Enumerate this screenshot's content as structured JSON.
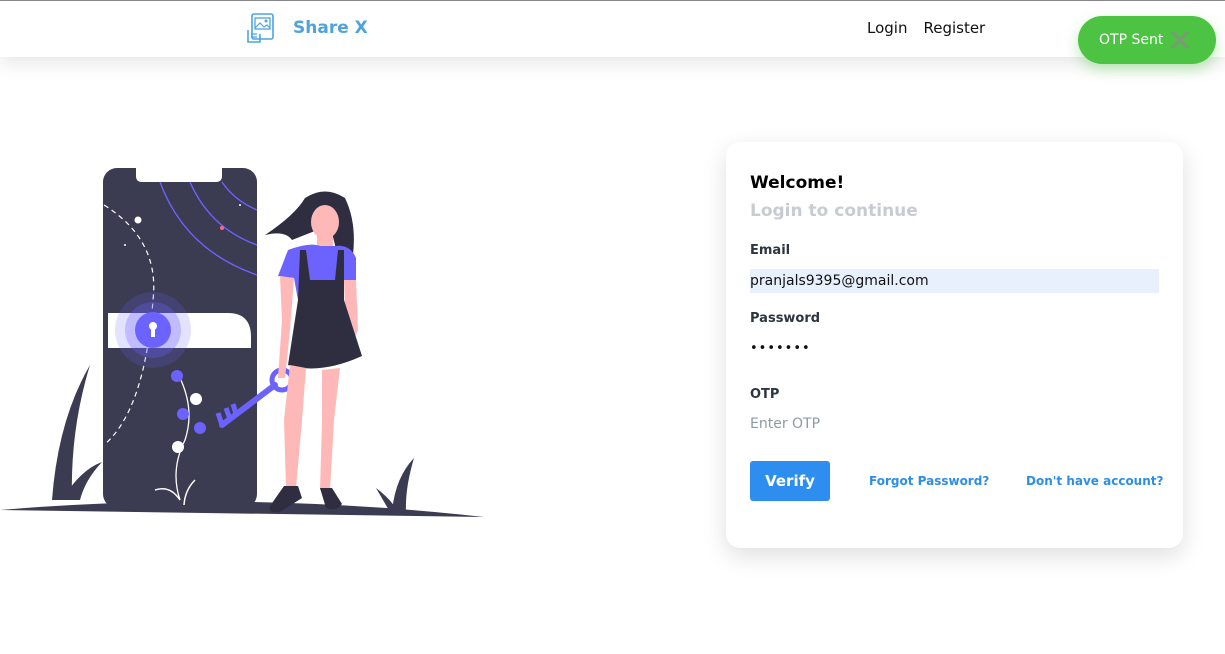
{
  "brand": {
    "name": "Share X",
    "logo_icon": "image-share-icon",
    "color": "#4ea3dd"
  },
  "nav": {
    "login": "Login",
    "register": "Register"
  },
  "toast": {
    "message": "OTP Sent",
    "close_icon": "close-icon",
    "color": "#4cc343"
  },
  "card": {
    "title": "Welcome!",
    "subtitle": "Login to continue",
    "email": {
      "label": "Email",
      "value": "pranjals9395@gmail.com"
    },
    "password": {
      "label": "Password",
      "value": "•••••••"
    },
    "otp": {
      "label": "OTP",
      "placeholder": "Enter OTP",
      "value": ""
    },
    "verify_button": "Verify",
    "forgot_link": "Forgot Password?",
    "register_link": "Don't have account?",
    "accent": "#2d8ef0"
  },
  "illustration": {
    "subject": "person-with-key-and-phone-illustration"
  }
}
